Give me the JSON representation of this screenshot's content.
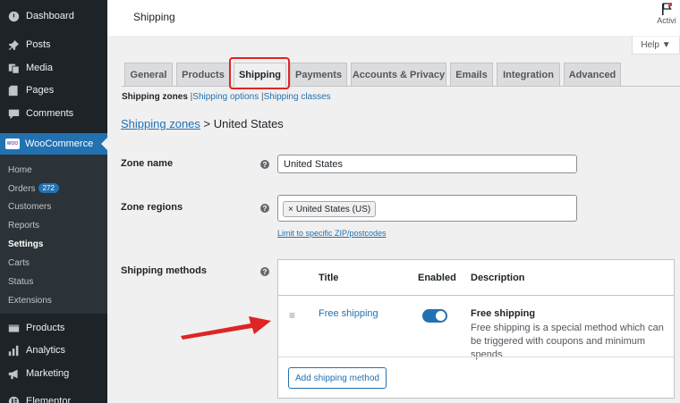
{
  "sidebar": {
    "items": [
      {
        "label": "Dashboard",
        "icon": "dashboard-icon"
      },
      {
        "label": "Posts",
        "icon": "pin-icon"
      },
      {
        "label": "Media",
        "icon": "media-icon"
      },
      {
        "label": "Pages",
        "icon": "pages-icon"
      },
      {
        "label": "Comments",
        "icon": "comment-icon"
      }
    ],
    "woocommerce": {
      "label": "WooCommerce",
      "icon": "woo-icon",
      "badge_text": "WOO"
    },
    "submenu": [
      {
        "label": "Home"
      },
      {
        "label": "Orders",
        "count": "272"
      },
      {
        "label": "Customers"
      },
      {
        "label": "Reports"
      },
      {
        "label": "Settings"
      },
      {
        "label": "Carts"
      },
      {
        "label": "Status"
      },
      {
        "label": "Extensions"
      }
    ],
    "items_after": [
      {
        "label": "Products",
        "icon": "products-icon"
      },
      {
        "label": "Analytics",
        "icon": "analytics-icon"
      },
      {
        "label": "Marketing",
        "icon": "megaphone-icon"
      },
      {
        "label": "Elementor",
        "icon": "elementor-icon"
      }
    ]
  },
  "header": {
    "title": "Shipping",
    "activity_label": "Activi",
    "help_label": "Help ▼"
  },
  "tabs": [
    {
      "label": "General"
    },
    {
      "label": "Products"
    },
    {
      "label": "Shipping"
    },
    {
      "label": "Payments"
    },
    {
      "label": "Accounts & Privacy"
    },
    {
      "label": "Emails"
    },
    {
      "label": "Integration"
    },
    {
      "label": "Advanced"
    }
  ],
  "subnav": {
    "zones": "Shipping zones",
    "sep1": "|",
    "options": "Shipping options",
    "sep2": "|",
    "classes": "Shipping classes"
  },
  "breadcrumb": {
    "link": "Shipping zones",
    "separator": ">",
    "current": "United States"
  },
  "form": {
    "zone_name_label": "Zone name",
    "zone_name_value": "United States",
    "zone_regions_label": "Zone regions",
    "region_chip": "United States (US)",
    "region_chip_remove": "×",
    "limit_link": "Limit to specific ZIP/postcodes",
    "shipping_methods_label": "Shipping methods",
    "help_glyph": "?"
  },
  "methods_table": {
    "headers": {
      "title": "Title",
      "enabled": "Enabled",
      "description": "Description"
    },
    "rows": [
      {
        "title": "Free shipping",
        "enabled": true,
        "description_title": "Free shipping",
        "description_text": "Free shipping is a special method which can be triggered with coupons and minimum spends."
      }
    ],
    "drag_glyph": "≡",
    "add_button": "Add shipping method"
  },
  "colors": {
    "sidebar_bg": "#1d2327",
    "accent": "#2271b1",
    "highlight": "#e02424"
  }
}
